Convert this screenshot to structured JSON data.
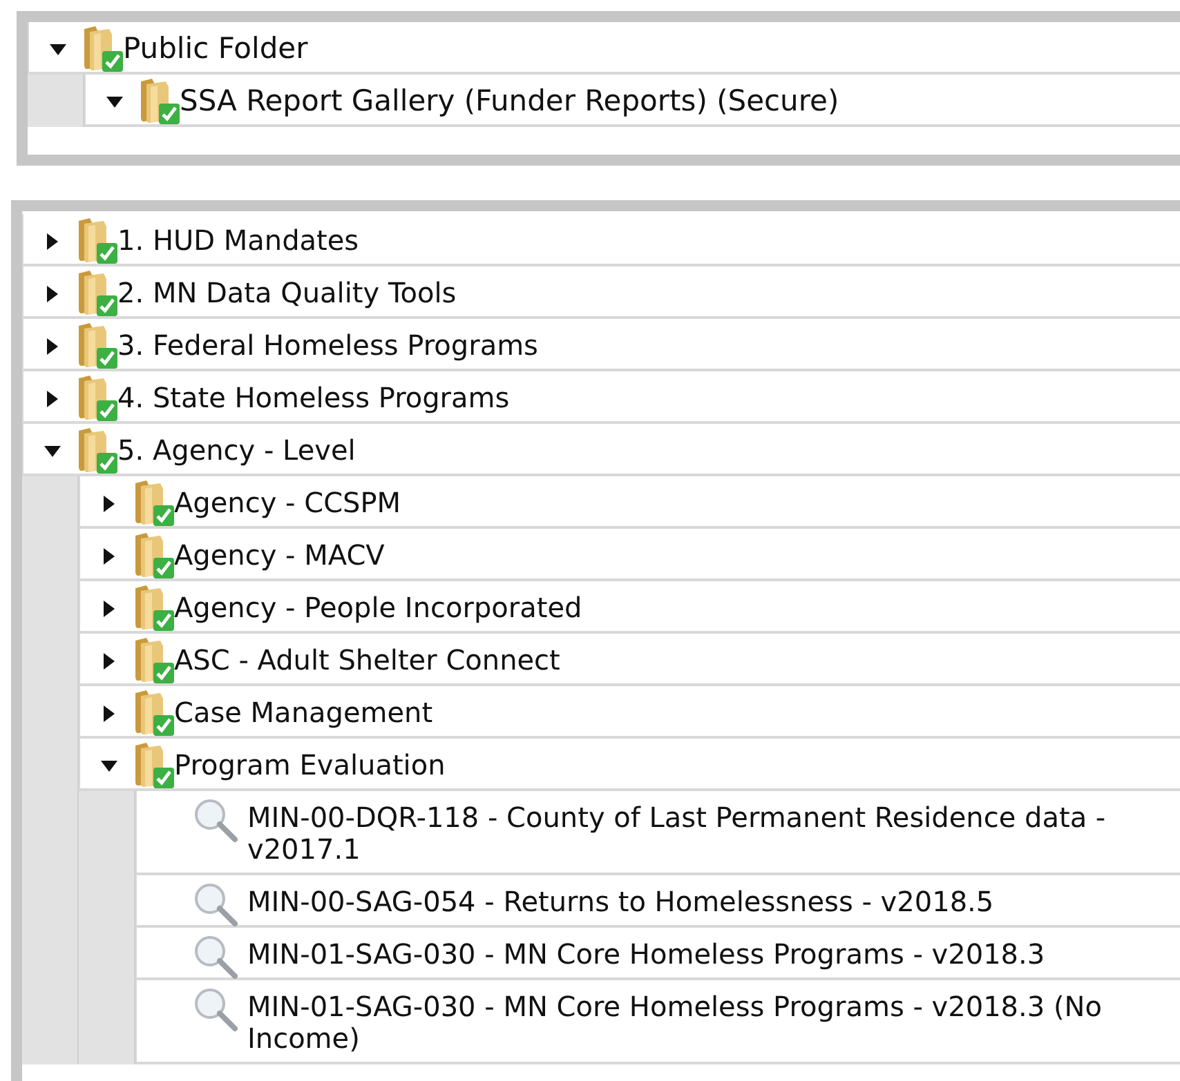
{
  "panels": [
    {
      "items": [
        {
          "kind": "folder",
          "label": "Public Folder",
          "expanded": true,
          "children": [
            {
              "kind": "folder",
              "label": "SSA Report Gallery (Funder Reports) (Secure)",
              "expanded": true
            }
          ]
        }
      ]
    },
    {
      "items": [
        {
          "kind": "folder",
          "label": "1. HUD Mandates",
          "expanded": false
        },
        {
          "kind": "folder",
          "label": "2. MN Data Quality Tools",
          "expanded": false
        },
        {
          "kind": "folder",
          "label": "3. Federal Homeless Programs",
          "expanded": false
        },
        {
          "kind": "folder",
          "label": "4. State Homeless Programs",
          "expanded": false
        },
        {
          "kind": "folder",
          "label": "5. Agency - Level",
          "expanded": true,
          "children": [
            {
              "kind": "folder",
              "label": "Agency - CCSPM",
              "expanded": false
            },
            {
              "kind": "folder",
              "label": "Agency - MACV",
              "expanded": false
            },
            {
              "kind": "folder",
              "label": "Agency - People Incorporated",
              "expanded": false
            },
            {
              "kind": "folder",
              "label": "ASC - Adult Shelter Connect",
              "expanded": false
            },
            {
              "kind": "folder",
              "label": "Case Management",
              "expanded": false
            },
            {
              "kind": "folder",
              "label": "Program Evaluation",
              "expanded": true,
              "children": [
                {
                  "kind": "report",
                  "label": "MIN-00-DQR-118 - County of Last Permanent Residence data - v2017.1"
                },
                {
                  "kind": "report",
                  "label": "MIN-00-SAG-054 - Returns to Homelessness - v2018.5"
                },
                {
                  "kind": "report",
                  "label": "MIN-01-SAG-030 - MN Core Homeless Programs - v2018.3"
                },
                {
                  "kind": "report",
                  "label": "MIN-01-SAG-030 - MN Core Homeless Programs - v2018.3 (No Income)"
                }
              ]
            }
          ]
        }
      ]
    }
  ]
}
